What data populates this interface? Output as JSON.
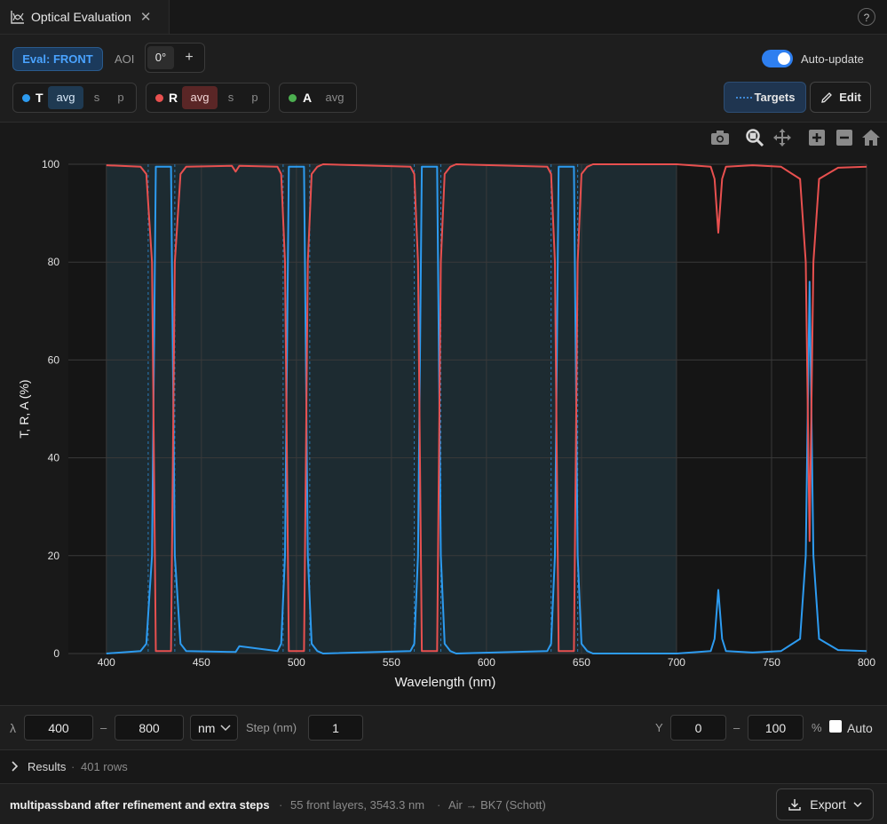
{
  "tab": {
    "title": "Optical Evaluation",
    "close": "✕",
    "help": "?"
  },
  "toolbar": {
    "eval_label": "Eval: FRONT",
    "aoi_label": "AOI",
    "aoi_value": "0°",
    "aoi_add": "+",
    "autoupdate_label": "Auto-update",
    "autoupdate_on": true
  },
  "series_groups": [
    {
      "letter": "T",
      "color": "#2d9bf0",
      "modes": [
        "avg",
        "s",
        "p"
      ],
      "active": "avg"
    },
    {
      "letter": "R",
      "color": "#e8504f",
      "modes": [
        "avg",
        "s",
        "p"
      ],
      "active": "avg"
    },
    {
      "letter": "A",
      "color": "#4caf50",
      "modes": [
        "avg"
      ],
      "active": ""
    }
  ],
  "buttons": {
    "targets": "Targets",
    "edit": "Edit"
  },
  "modebar": [
    "camera-icon",
    "zoom-icon",
    "pan-icon",
    "zoom-in-icon",
    "zoom-out-icon",
    "home-icon"
  ],
  "chart_data": {
    "type": "line",
    "xlabel": "Wavelength (nm)",
    "ylabel": "T, R, A (%)",
    "xlim": [
      380,
      800
    ],
    "ylim": [
      0,
      100
    ],
    "xticks": [
      400,
      450,
      500,
      550,
      600,
      650,
      700,
      750,
      800
    ],
    "yticks": [
      0,
      20,
      40,
      60,
      80,
      100
    ],
    "grid": true,
    "shaded_region_x": [
      400,
      700
    ],
    "passbands": [
      [
        422,
        436
      ],
      [
        493,
        507
      ],
      [
        562,
        576
      ],
      [
        634,
        648
      ]
    ],
    "series": [
      {
        "name": "T",
        "color": "#2d9bf0",
        "x": [
          400,
          418,
          421,
          424,
          426,
          434,
          436,
          439,
          442,
          468,
          470,
          490,
          492,
          494,
          496,
          504,
          506,
          508,
          511,
          514,
          560,
          562,
          564,
          566,
          574,
          576,
          578,
          581,
          584,
          632,
          634,
          636,
          638,
          646,
          648,
          650,
          653,
          656,
          700,
          718,
          720,
          722,
          724,
          726,
          740,
          755,
          765,
          768,
          770,
          772,
          775,
          785,
          800
        ],
        "values": [
          0,
          0.5,
          2,
          20,
          99.5,
          99.5,
          20,
          2,
          0.5,
          0.3,
          1.5,
          0.5,
          2,
          20,
          99.5,
          99.5,
          20,
          2,
          0.5,
          0,
          0.5,
          2,
          20,
          99.5,
          99.5,
          20,
          2,
          0.5,
          0,
          0.5,
          2,
          20,
          99.5,
          99.5,
          20,
          2,
          0.5,
          0,
          0,
          0.5,
          3,
          13,
          3,
          0.5,
          0.2,
          0.5,
          3,
          20,
          76,
          20,
          3,
          0.7,
          0.5
        ]
      },
      {
        "name": "R",
        "color": "#e8504f",
        "x": [
          400,
          418,
          421,
          424,
          426,
          434,
          436,
          439,
          442,
          466,
          468,
          470,
          490,
          492,
          494,
          496,
          504,
          506,
          508,
          511,
          514,
          560,
          562,
          564,
          566,
          574,
          576,
          578,
          581,
          584,
          632,
          634,
          636,
          638,
          646,
          648,
          650,
          653,
          656,
          700,
          718,
          720,
          722,
          724,
          726,
          740,
          755,
          765,
          768,
          770,
          772,
          775,
          785,
          800
        ],
        "values": [
          99.8,
          99.5,
          98,
          80,
          0.5,
          0.5,
          80,
          98,
          99.5,
          99.7,
          98.5,
          99.7,
          99.5,
          98,
          80,
          0.5,
          0.5,
          80,
          98,
          99.5,
          100,
          99.5,
          98,
          80,
          0.5,
          0.5,
          80,
          98,
          99.5,
          100,
          99.5,
          98,
          80,
          0.5,
          0.5,
          80,
          98,
          99.5,
          100,
          100,
          99.5,
          97,
          86,
          97,
          99.5,
          99.8,
          99.5,
          97,
          80,
          23,
          80,
          97,
          99.3,
          99.5
        ]
      }
    ]
  },
  "range": {
    "lambda_label": "λ",
    "lambda_min": "400",
    "dash": "–",
    "lambda_max": "800",
    "unit": "nm",
    "step_label": "Step (nm)",
    "step": "1",
    "y_label": "Y",
    "y_min": "0",
    "y_max": "100",
    "y_unit": "%",
    "auto_label": "Auto"
  },
  "results": {
    "label": "Results",
    "sep": "·",
    "rows": "401 rows"
  },
  "status": {
    "design_name": "multipassband after refinement and extra steps",
    "sep": "·",
    "layers": "55 front layers, 3543.3 nm",
    "media": "Air → BK7 (Schott)",
    "export": "Export"
  }
}
